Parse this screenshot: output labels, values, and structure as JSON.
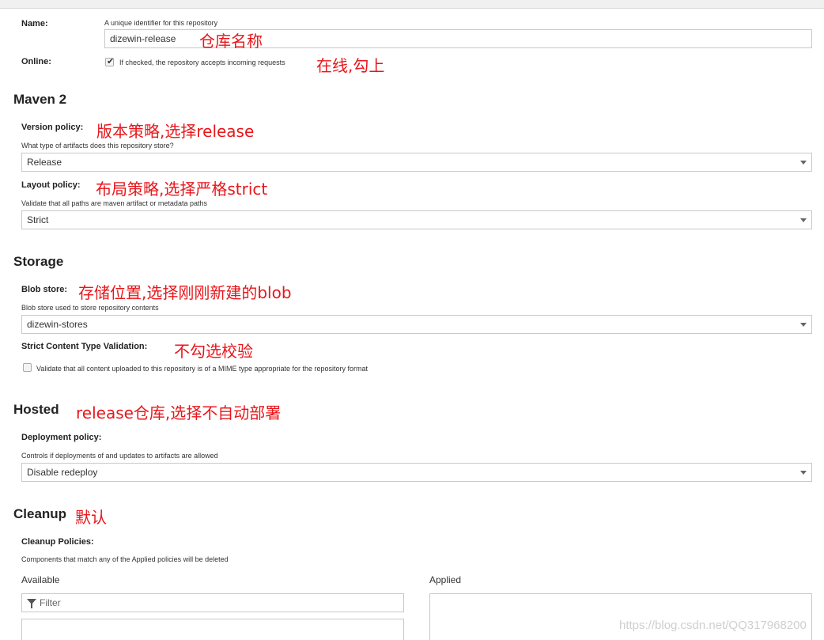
{
  "name": {
    "label": "Name:",
    "help": "A unique identifier for this repository",
    "value": "dizewin-release",
    "annotation": "仓库名称"
  },
  "online": {
    "label": "Online:",
    "checked": true,
    "checkbox_text": "If checked, the repository accepts incoming requests",
    "annotation": "在线,勾上"
  },
  "maven": {
    "title": "Maven 2",
    "version_policy": {
      "label": "Version policy:",
      "annotation": "版本策略,选择release",
      "help": "What type of artifacts does this repository store?",
      "value": "Release"
    },
    "layout_policy": {
      "label": "Layout policy:",
      "annotation": "布局策略,选择严格strict",
      "help": "Validate that all paths are maven artifact or metadata paths",
      "value": "Strict"
    }
  },
  "storage": {
    "title": "Storage",
    "blob_store": {
      "label": "Blob store:",
      "annotation": "存储位置,选择刚刚新建的blob",
      "help": "Blob store used to store repository contents",
      "value": "dizewin-stores"
    },
    "strict_validation": {
      "label": "Strict Content Type Validation:",
      "annotation": "不勾选校验",
      "checked": false,
      "checkbox_text": "Validate that all content uploaded to this repository is of a MIME type appropriate for the repository format"
    }
  },
  "hosted": {
    "title": "Hosted",
    "annotation": "release仓库,选择不自动部署",
    "deployment_policy": {
      "label": "Deployment policy:",
      "help": "Controls if deployments of and updates to artifacts are allowed",
      "value": "Disable redeploy"
    }
  },
  "cleanup": {
    "title": "Cleanup",
    "annotation": "默认",
    "policies_label": "Cleanup Policies:",
    "help": "Components that match any of the Applied policies will be deleted",
    "available_label": "Available",
    "applied_label": "Applied",
    "filter_placeholder": "Filter"
  },
  "watermark": "https://blog.csdn.net/QQ317968200",
  "colors": {
    "annotation": "#e8161b",
    "border": "#c8c8c8"
  }
}
